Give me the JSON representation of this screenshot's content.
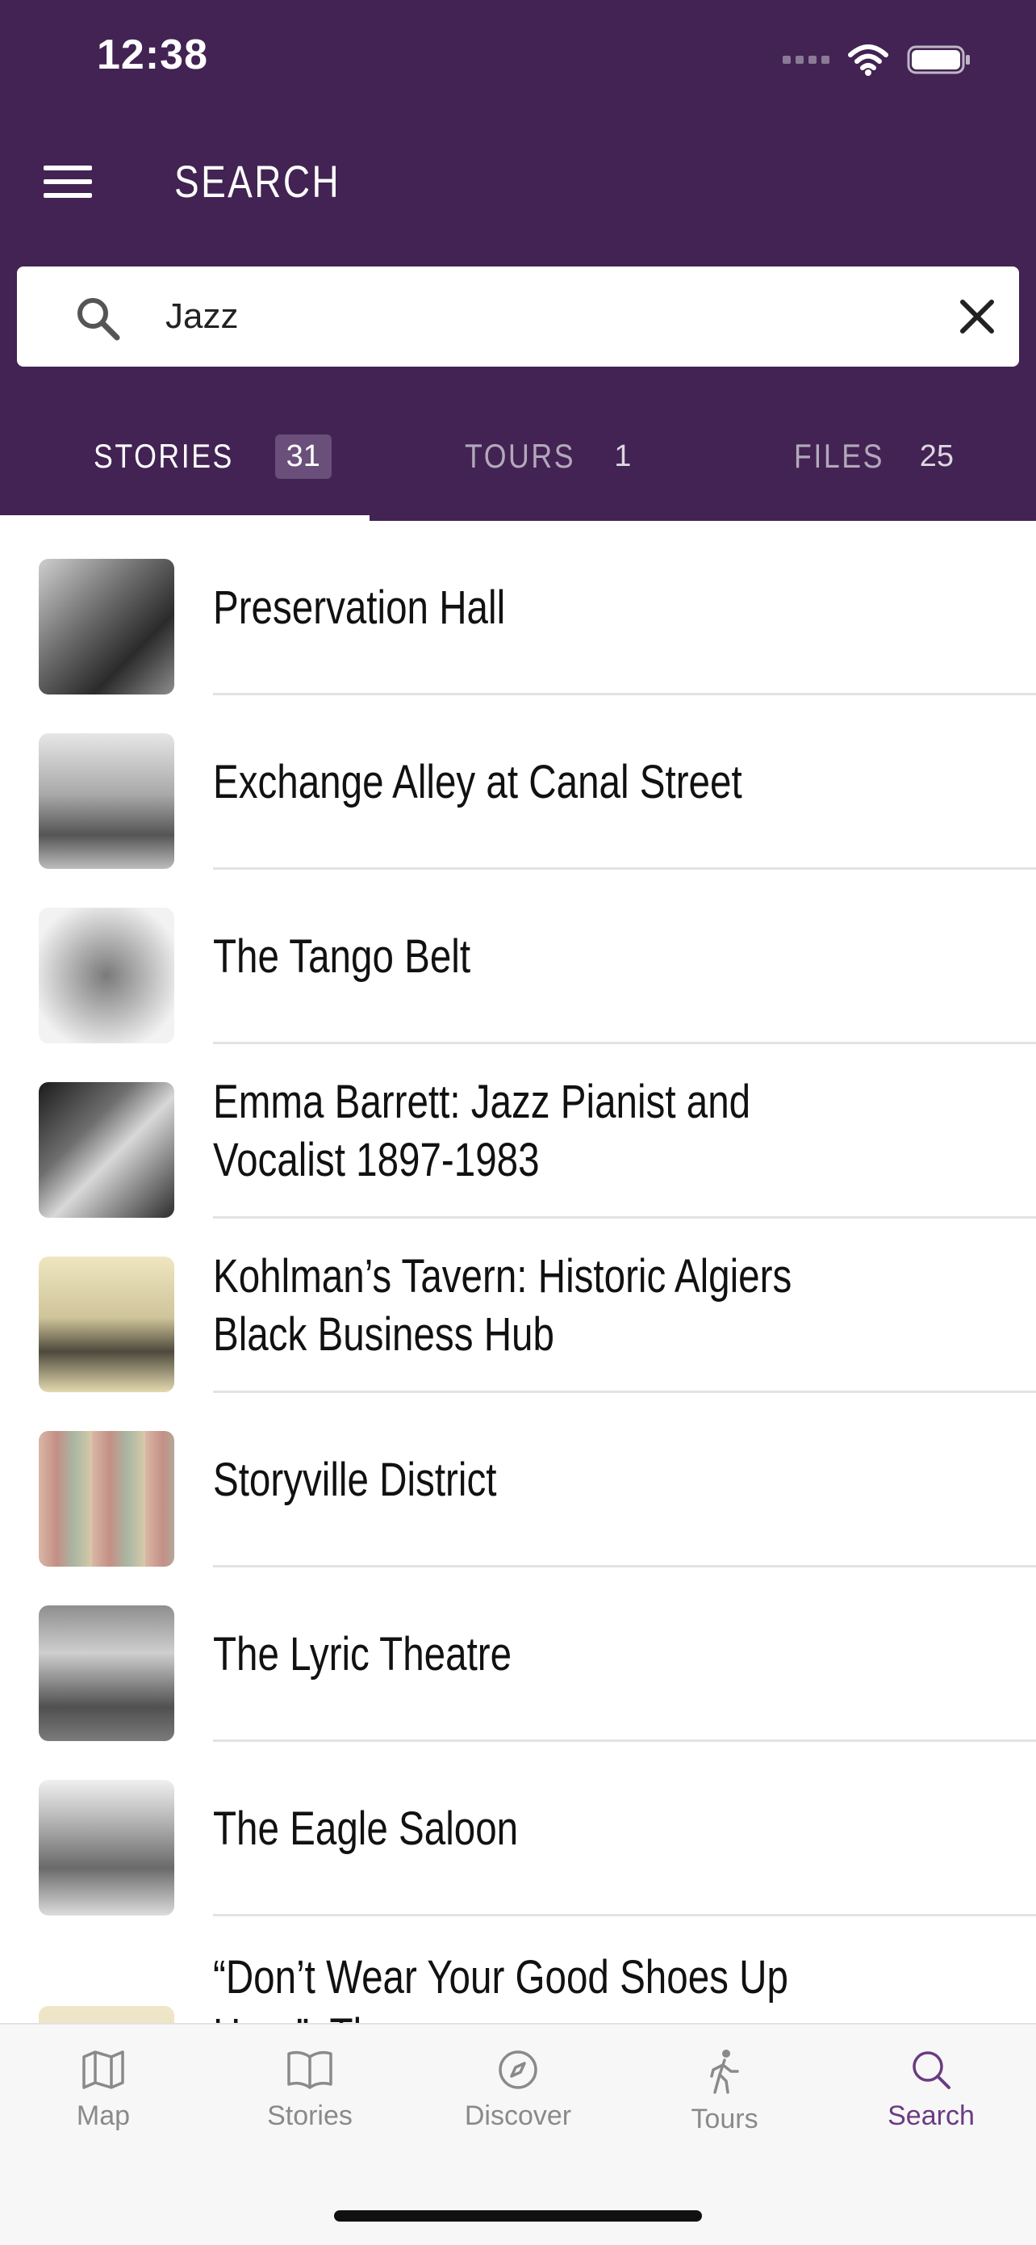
{
  "status_bar": {
    "time": "12:38",
    "icons": [
      "signal-icon",
      "wifi-icon",
      "battery-icon"
    ]
  },
  "header": {
    "title": "SEARCH",
    "menu_icon": "hamburger-menu-icon"
  },
  "search": {
    "value": "Jazz",
    "icon": "search-icon",
    "clear_icon": "close-icon"
  },
  "tabs": [
    {
      "label": "STORIES",
      "count": "31",
      "active": true
    },
    {
      "label": "TOURS",
      "count": "1",
      "active": false
    },
    {
      "label": "FILES",
      "count": "25",
      "active": false
    }
  ],
  "results": [
    {
      "title": "Preservation Hall"
    },
    {
      "title": "Exchange Alley at Canal Street"
    },
    {
      "title": "The Tango Belt"
    },
    {
      "title": "Emma Barrett: Jazz Pianist and Vocalist 1897-1983"
    },
    {
      "title": "Kohlman’s Tavern: Historic Algiers Black Business Hub"
    },
    {
      "title": "Storyville District"
    },
    {
      "title": "The Lyric Theatre"
    },
    {
      "title": "The Eagle Saloon"
    },
    {
      "title": "“Don’t Wear Your Good Shoes Up Here”: The"
    }
  ],
  "bottom_nav": [
    {
      "label": "Map",
      "icon": "map-icon",
      "active": false
    },
    {
      "label": "Stories",
      "icon": "book-icon",
      "active": false
    },
    {
      "label": "Discover",
      "icon": "compass-icon",
      "active": false
    },
    {
      "label": "Tours",
      "icon": "walking-person-icon",
      "active": false
    },
    {
      "label": "Search",
      "icon": "search-icon",
      "active": true
    }
  ],
  "colors": {
    "header_bg": "#422353",
    "active_nav": "#6b3b82",
    "tab_badge_bg": "#6a4f7a"
  }
}
